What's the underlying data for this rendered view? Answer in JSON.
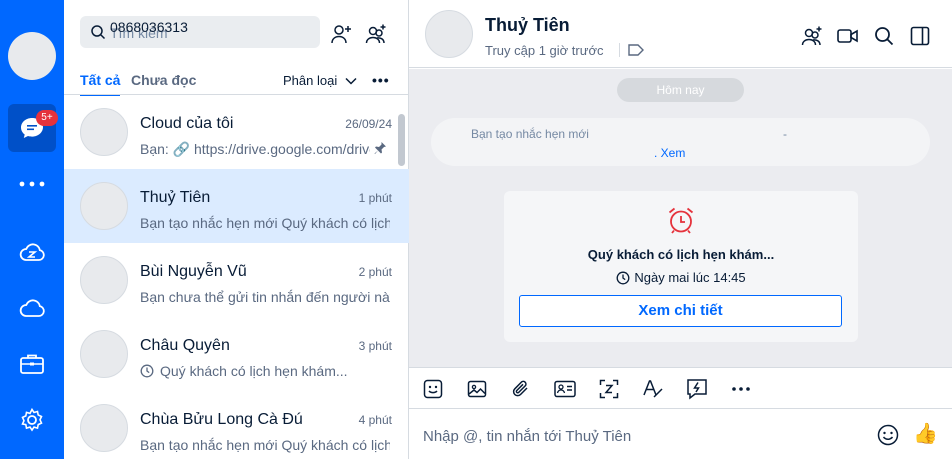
{
  "rail": {
    "chat_badge": "5+"
  },
  "search": {
    "placeholder": "Tìm kiếm",
    "value": "0868036313"
  },
  "tabs": {
    "all": "Tất cả",
    "unread": "Chưa đọc",
    "classify": "Phân loại",
    "more": "•••"
  },
  "conversations": [
    {
      "name": "Cloud của tôi",
      "time": "26/09/24",
      "preview": "Bạn: 🔗 https://drive.google.com/drive/folders",
      "pinned": true
    },
    {
      "name": "Thuỷ Tiên",
      "time": "1 phút",
      "preview": "Bạn tạo nhắc hẹn mới Quý khách có lịch hẹn",
      "selected": true
    },
    {
      "name": "Bùi Nguyễn Vũ",
      "time": "2 phút",
      "preview": "Bạn chưa thể gửi tin nhắn đến người này"
    },
    {
      "name": "Châu Quyên",
      "time": "3 phút",
      "preview": "Quý khách có lịch hẹn khám..."
    },
    {
      "name": "Chùa Bửu Long Cà Đú",
      "time": "4 phút",
      "preview": "Bạn tạo nhắc hẹn mới Quý khách có lịch hẹn"
    }
  ],
  "header": {
    "name": "Thuỷ Tiên",
    "status": "Truy cập 1 giờ trước"
  },
  "messages": {
    "day": "Hôm nay",
    "system_text": "Bạn tạo nhắc hẹn mới",
    "system_dash": "-",
    "system_link": ". Xem",
    "card_title": "Quý khách có lịch hẹn khám...",
    "card_time": "Ngày mai lúc 14:45",
    "card_button": "Xem chi tiết"
  },
  "composer": {
    "placeholder": "Nhập @, tin nhắn tới Thuỷ Tiên",
    "like_emoji": "👍"
  },
  "colors": {
    "brand": "#0068ff",
    "selected_row": "#dbebff",
    "alarm": "#e5323c"
  }
}
